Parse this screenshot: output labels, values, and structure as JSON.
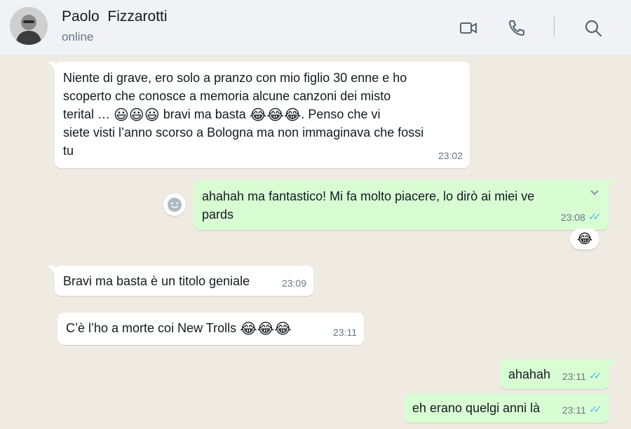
{
  "header": {
    "contact_name": "Paolo  Fizzarotti",
    "status": "online",
    "icons": [
      "video-call-icon",
      "voice-call-icon",
      "search-icon"
    ]
  },
  "colors": {
    "header_bg": "#f0f2f5",
    "chat_bg": "#efeae2",
    "incoming_bubble": "#ffffff",
    "outgoing_bubble": "#d9fdd3",
    "read_ticks": "#53bdeb",
    "meta_text": "#667781"
  },
  "messages": [
    {
      "direction": "in",
      "line1": "Niente di grave, ero solo a pranzo con mio figlio 30 enne e ho",
      "line2": "scoperto che conosce a memoria alcune canzoni dei misto",
      "line3_a": "terital … ",
      "line3_emoji_a": "😃😃😃",
      "line3_b": " bravi ma basta ",
      "line3_emoji_b": "😂😂😂",
      "line3_c": ". Penso che vi",
      "line4": "siete visti l’anno scorso a Bologna ma non immaginava che fossi",
      "line5": "tu",
      "time": "23:02"
    },
    {
      "direction": "out",
      "line1": "ahahah ma fantastico!  Mi fa molto piacere, lo dirò ai miei ve",
      "line2": "pards",
      "time": "23:08",
      "status": "read",
      "reaction": "😂"
    },
    {
      "direction": "in",
      "text": "Bravi ma basta è un titolo geniale",
      "time": "23:09"
    },
    {
      "direction": "in",
      "text": "C’è l’ho a morte coi New Trolls ",
      "emoji": "😂😂😂",
      "time": "23:11"
    },
    {
      "direction": "out",
      "text": "ahahah",
      "time": "23:11",
      "status": "read"
    },
    {
      "direction": "out",
      "text": "eh erano quelgi anni là",
      "time": "23:11",
      "status": "read"
    }
  ]
}
